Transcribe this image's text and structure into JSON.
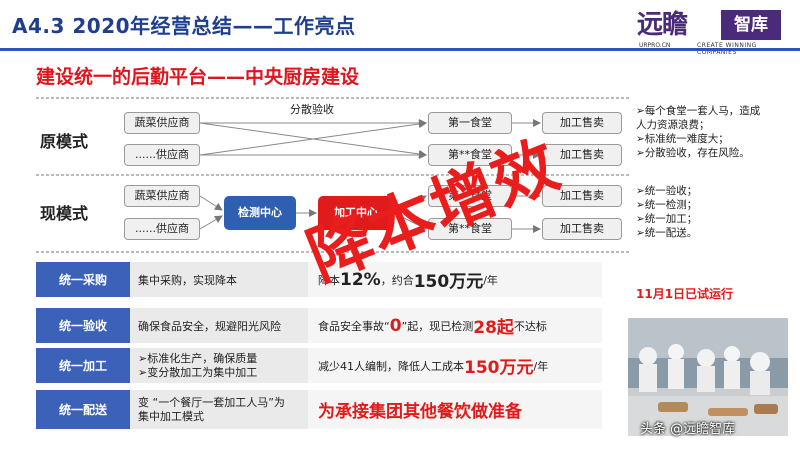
{
  "header": {
    "title": "A4.3  2020年经营总结——工作亮点",
    "logo_calligraphy": "远瞻",
    "logo_name": "智库",
    "logo_sub1": "URPRO.CN",
    "logo_sub2": "CREATE WINNING COMPANIES"
  },
  "subtitle": "建设统一的后勤平台——中央厨房建设",
  "old_mode": {
    "label": "原模式",
    "supplier1": "蔬菜供应商",
    "supplier2": "......供应商",
    "center_label": "分散验收",
    "canteen1": "第一食堂",
    "canteen2": "第**食堂",
    "sale1": "加工售卖",
    "sale2": "加工售卖",
    "bullets": [
      "➢每个食堂一套人马，造成",
      "人力资源浪费；",
      "➢标准统一难度大；",
      "➢分散验收，存在风险。"
    ]
  },
  "new_mode": {
    "label": "现模式",
    "supplier1": "蔬菜供应商",
    "supplier2": "......供应商",
    "test_center": "检测中心",
    "process_center": "加工中心",
    "canteen1": "第一食堂",
    "canteen2": "第**食堂",
    "sale1": "加工售卖",
    "sale2": "加工售卖",
    "bullets": [
      "➢统一验收；",
      "➢统一检测；",
      "➢统一加工；",
      "➢统一配送。"
    ]
  },
  "stamp": "降本增效",
  "table": [
    {
      "label": "统一采购",
      "mid": [
        "集中采购，实现降本"
      ],
      "right_pre": "降本",
      "right_big": "12%",
      "right_mid": "，约合",
      "right_big2": "150万元",
      "right_post": "/年"
    },
    {
      "label": "统一验收",
      "mid": [
        "确保食品安全，规避阳光风险"
      ],
      "right_pre": "食品安全事故“",
      "right_big": "0",
      "right_mid": "”起，现已检测",
      "right_big2": "28起",
      "right_post": "不达标"
    },
    {
      "label": "统一加工",
      "mid": [
        "➢标准化生产，确保质量",
        "➢变分散加工为集中加工"
      ],
      "right_pre": "减少41人编制，降低人工成本",
      "right_big": "150万元",
      "right_mid": "",
      "right_big2": "",
      "right_post": "/年"
    },
    {
      "label": "统一配送",
      "mid": [
        "变 “一个餐厅一套加工人马”为",
        "集中加工模式"
      ],
      "right_pre": "",
      "right_big": "为承接集团其他餐饮做准备",
      "right_mid": "",
      "right_big2": "",
      "right_post": ""
    }
  ],
  "note": "11月1日已试运行",
  "watermark": "头条 @远瞻智库",
  "colors": {
    "brand_blue": "#2f5fb0",
    "accent_red": "#e01b1b",
    "logo_purple": "#4a2a7a"
  }
}
